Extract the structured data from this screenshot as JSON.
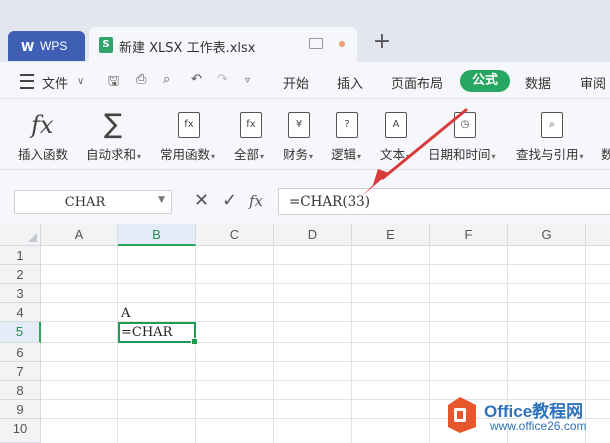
{
  "titlebar": {
    "app_tab": {
      "icon": "wps-logo-icon",
      "label": "WPS"
    },
    "file_tab": {
      "icon": "spreadsheet-icon",
      "title": "新建 XLSX 工作表.xlsx"
    },
    "new_tab_label": "+"
  },
  "menubar": {
    "file_label": "文件",
    "tabs": [
      "开始",
      "插入",
      "页面布局",
      "公式",
      "数据",
      "审阅"
    ],
    "active_tab": "公式"
  },
  "ribbon": {
    "items": [
      {
        "label": "插入函数",
        "icon": "fx-icon",
        "caret": false
      },
      {
        "label": "自动求和",
        "icon": "sigma-icon",
        "caret": true
      },
      {
        "label": "常用函数",
        "icon": "common-functions-icon",
        "caret": true
      },
      {
        "label": "全部",
        "icon": "all-functions-icon",
        "caret": true
      },
      {
        "label": "财务",
        "icon": "finance-icon",
        "caret": true
      },
      {
        "label": "逻辑",
        "icon": "logic-icon",
        "caret": true
      },
      {
        "label": "文本",
        "icon": "text-icon",
        "caret": true
      },
      {
        "label": "日期和时间",
        "icon": "datetime-icon",
        "caret": true
      },
      {
        "label": "查找与引用",
        "icon": "lookup-icon",
        "caret": true
      },
      {
        "label": "数",
        "icon": "math-icon",
        "caret": false
      }
    ]
  },
  "formula_bar": {
    "name_box": "CHAR",
    "cancel_symbol": "✕",
    "confirm_symbol": "✓",
    "fx_symbol": "fx",
    "content": "=CHAR(33)"
  },
  "sheet": {
    "columns": [
      "A",
      "B",
      "C",
      "D",
      "E",
      "F",
      "G"
    ],
    "rows": [
      "1",
      "2",
      "3",
      "4",
      "5",
      "6",
      "7",
      "8",
      "9",
      "10"
    ],
    "selected_column": "B",
    "selected_row": "5",
    "cells": {
      "B4": "A",
      "B5": "=CHAR"
    }
  },
  "watermark": {
    "line1": "Office教程网",
    "line2": "www.office26.com"
  },
  "annotation": {
    "color": "#d93a3a"
  },
  "colors": {
    "accent": "#26a762",
    "wps_tab": "#3e5fb3",
    "watermark": "#2f73bc"
  }
}
